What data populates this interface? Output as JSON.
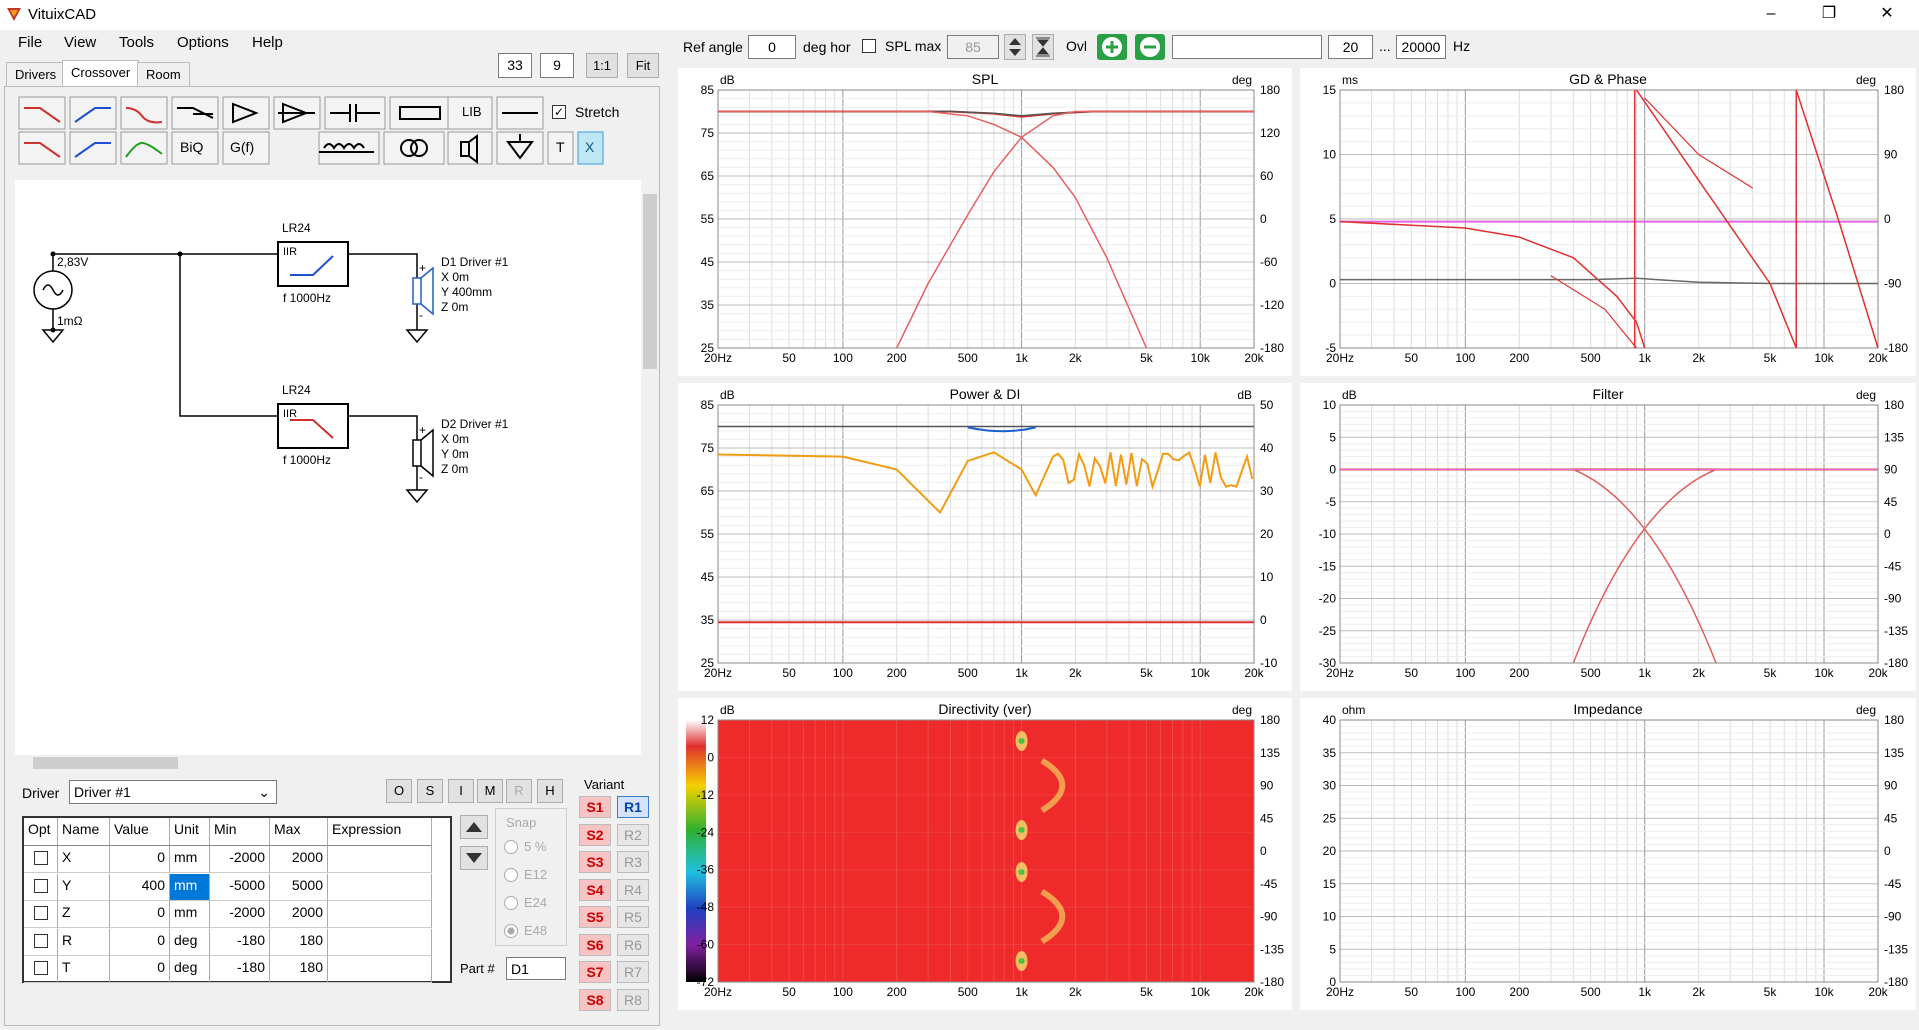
{
  "app": {
    "title": "VituixCAD"
  },
  "menu": [
    "File",
    "View",
    "Tools",
    "Options",
    "Help"
  ],
  "tabs": [
    "Drivers",
    "Crossover",
    "Room"
  ],
  "toolbar": {
    "zoom": "33",
    "zoom2": "9",
    "ratio": "1:1",
    "fit": "Fit",
    "lib": "LIB",
    "biq": "BiQ",
    "gf": "G(f)",
    "t": "T",
    "x": "X",
    "stretch": "Stretch"
  },
  "top": {
    "ref_angle_label": "Ref angle",
    "ref_angle": "0",
    "deg_hor": "deg hor",
    "spl_max": "SPL max",
    "spl_val": "85",
    "ovl": "Ovl",
    "f_low": "20",
    "dots": "...",
    "f_high": "20000",
    "hz": "Hz"
  },
  "schematic": {
    "source_v": "2,83V",
    "source_r": "1mΩ",
    "f1": {
      "name": "LR24",
      "type": "IIR",
      "freq": "f   1000Hz"
    },
    "f2": {
      "name": "LR24",
      "type": "IIR",
      "freq": "f   1000Hz"
    },
    "d1": {
      "name": "D1 Driver #1",
      "x": "X 0m",
      "y": "Y 400mm",
      "z": "Z 0m",
      "plus": "+",
      "minus": "-"
    },
    "d2": {
      "name": "D2 Driver #1",
      "x": "X 0m",
      "y": "Y 0m",
      "z": "Z 0m",
      "plus": "+",
      "minus": "-"
    }
  },
  "driver": {
    "label": "Driver",
    "selected": "Driver #1",
    "btns": [
      "O",
      "S",
      "I",
      "M",
      "R",
      "H"
    ],
    "variant": "Variant",
    "snap": "Snap",
    "snap_opts": [
      "5 %",
      "E12",
      "E24",
      "E48"
    ],
    "part_label": "Part #",
    "part": "D1"
  },
  "params": {
    "headers": [
      "Opt",
      "Name",
      "Value",
      "Unit",
      "Min",
      "Max",
      "Expression"
    ],
    "rows": [
      {
        "name": "X",
        "value": "0",
        "unit": "mm",
        "min": "-2000",
        "max": "2000",
        "expr": ""
      },
      {
        "name": "Y",
        "value": "400",
        "unit": "mm",
        "min": "-5000",
        "max": "5000",
        "expr": ""
      },
      {
        "name": "Z",
        "value": "0",
        "unit": "mm",
        "min": "-2000",
        "max": "2000",
        "expr": ""
      },
      {
        "name": "R",
        "value": "0",
        "unit": "deg",
        "min": "-180",
        "max": "180",
        "expr": ""
      },
      {
        "name": "T",
        "value": "0",
        "unit": "deg",
        "min": "-180",
        "max": "180",
        "expr": ""
      }
    ]
  },
  "variants": {
    "s": [
      "S1",
      "S2",
      "S3",
      "S4",
      "S5",
      "S6",
      "S7",
      "S8"
    ],
    "r": [
      "R1",
      "R2",
      "R3",
      "R4",
      "R5",
      "R6",
      "R7",
      "R8"
    ]
  },
  "chart_data": [
    {
      "type": "line",
      "title": "SPL",
      "lunit": "dB",
      "runit": "deg",
      "y_left": [
        "85",
        "75",
        "65",
        "55",
        "45",
        "35",
        "25"
      ],
      "y_right": [
        "180",
        "120",
        "60",
        "0",
        "-60",
        "-120",
        "-180"
      ],
      "x_ticks": [
        "20Hz",
        "50",
        "100",
        "200",
        "500",
        "1k",
        "2k",
        "5k",
        "10k",
        "20k"
      ],
      "series": [
        {
          "color": "#e03030",
          "x": [
            20,
            400,
            700,
            1000,
            1500,
            2500,
            5000,
            20000
          ],
          "y": [
            80,
            80,
            79.5,
            78.8,
            79.5,
            80,
            80,
            80
          ]
        },
        {
          "color": "#555555",
          "x": [
            20,
            400,
            700,
            1000,
            1500,
            2500,
            5000,
            20000
          ],
          "y": [
            80,
            80,
            79.6,
            79,
            79.6,
            80,
            80,
            80
          ]
        },
        {
          "color": "#e66060",
          "x": [
            200,
            300,
            500,
            700,
            1000,
            1500,
            2000,
            3000,
            10000,
            20000
          ],
          "y": [
            25,
            40,
            56,
            66,
            74,
            79,
            80,
            80,
            80,
            80
          ]
        },
        {
          "color": "#e66060",
          "x": [
            20,
            300,
            500,
            700,
            1000,
            1500,
            2000,
            3000,
            5000
          ],
          "y": [
            80,
            80,
            79,
            77,
            74,
            67,
            60,
            46,
            25
          ]
        }
      ]
    },
    {
      "type": "line",
      "title": "GD & Phase",
      "lunit": "ms",
      "runit": "deg",
      "y_left": [
        "15",
        "10",
        "5",
        "0",
        "-5"
      ],
      "y_right": [
        "180",
        "90",
        "0",
        "-90",
        "-180"
      ],
      "x_ticks": [
        "20Hz",
        "50",
        "100",
        "200",
        "500",
        "1k",
        "2k",
        "5k",
        "10k",
        "20k"
      ],
      "series": [
        {
          "color": "#e066e0",
          "x": [
            20,
            20000
          ],
          "y": [
            4.8,
            4.8
          ]
        },
        {
          "color": "#e03030",
          "x": [
            20,
            100,
            200,
            400,
            700,
            900,
            1000
          ],
          "y": [
            4.8,
            4.3,
            3.6,
            2,
            -1,
            -3,
            -5
          ]
        },
        {
          "color": "#666666",
          "x": [
            20,
            500,
            900,
            2000,
            5000,
            20000
          ],
          "y": [
            0.3,
            0.3,
            0.4,
            0.1,
            0,
            0
          ]
        }
      ]
    },
    {
      "type": "line",
      "title": "Power & DI",
      "lunit": "dB",
      "runit": "dB",
      "y_left": [
        "85",
        "75",
        "65",
        "55",
        "45",
        "35",
        "25"
      ],
      "y_right": [
        "50",
        "40",
        "30",
        "20",
        "10",
        "0",
        "-10"
      ],
      "x_ticks": [
        "20Hz",
        "50",
        "100",
        "200",
        "500",
        "1k",
        "2k",
        "5k",
        "10k",
        "20k"
      ],
      "series": [
        {
          "color": "#e03030",
          "x": [
            20,
            20000
          ],
          "y": [
            34.5,
            34.5
          ]
        },
        {
          "color": "#555555",
          "x": [
            20,
            20000
          ],
          "y": [
            80,
            80
          ]
        }
      ]
    },
    {
      "type": "line",
      "title": "Filter",
      "lunit": "dB",
      "runit": "deg",
      "y_left": [
        "10",
        "5",
        "0",
        "-5",
        "-10",
        "-15",
        "-20",
        "-25",
        "-30"
      ],
      "y_right": [
        "180",
        "135",
        "90",
        "45",
        "0",
        "-45",
        "-90",
        "-135",
        "-180"
      ],
      "x_ticks": [
        "20Hz",
        "50",
        "100",
        "200",
        "500",
        "1k",
        "2k",
        "5k",
        "10k",
        "20k"
      ],
      "series": [
        {
          "color": "#e03030",
          "x": [
            20,
            20000
          ],
          "y": [
            0,
            0
          ]
        }
      ]
    },
    {
      "type": "heatmap",
      "title": "Directivity (ver)",
      "lunit": "dB",
      "runit": "deg",
      "y_left": [
        "12",
        "0",
        "-12",
        "-24",
        "-36",
        "-48",
        "-60",
        "-72"
      ],
      "y_right": [
        "180",
        "135",
        "90",
        "45",
        "0",
        "-45",
        "-90",
        "-135",
        "-180"
      ],
      "x_ticks": [
        "20Hz",
        "50",
        "100",
        "200",
        "500",
        "1k",
        "2k",
        "5k",
        "10k",
        "20k"
      ]
    },
    {
      "type": "line",
      "title": "Impedance",
      "lunit": "ohm",
      "runit": "deg",
      "y_left": [
        "40",
        "35",
        "30",
        "25",
        "20",
        "15",
        "10",
        "5",
        "0"
      ],
      "y_right": [
        "180",
        "135",
        "90",
        "45",
        "0",
        "-45",
        "-90",
        "-135",
        "-180"
      ],
      "x_ticks": [
        "20Hz",
        "50",
        "100",
        "200",
        "500",
        "1k",
        "2k",
        "5k",
        "10k",
        "20k"
      ],
      "series": []
    }
  ],
  "colors": {
    "accent": "#3a7bd5",
    "red": "#e03030",
    "heat": "#ee2a2a"
  }
}
